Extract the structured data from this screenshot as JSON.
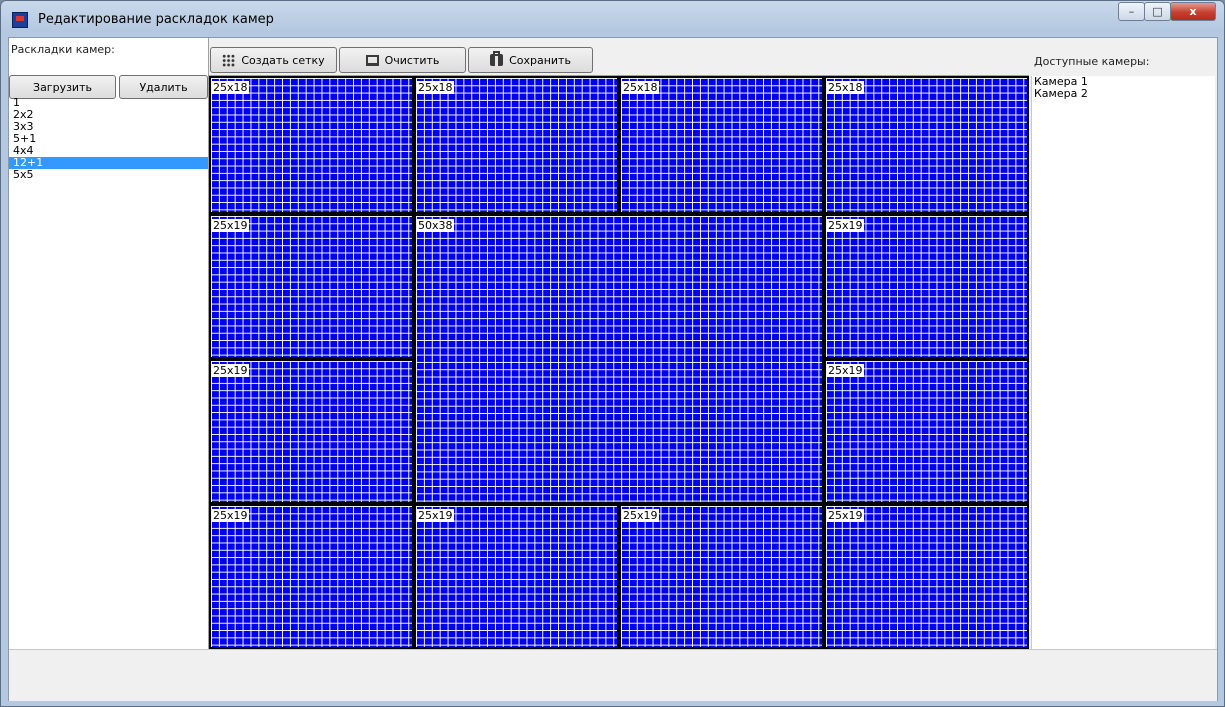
{
  "window": {
    "title": "Редактирование раскладок камер",
    "controls": {
      "minimize": "–",
      "maximize": "□",
      "close": "x"
    }
  },
  "left_panel": {
    "label": "Раскладки камер:",
    "load_label": "Загрузить",
    "delete_label": "Удалить",
    "layouts": [
      "1",
      "2x2",
      "3x3",
      "5+1",
      "4x4",
      "12+1",
      "5x5"
    ],
    "selected_index": 5
  },
  "toolbar": {
    "create_grid_label": "Создать сетку",
    "clear_label": "Очистить",
    "save_label": "Сохранить",
    "icons": {
      "create_grid": "grid-icon",
      "clear": "monitor-icon",
      "save": "briefcase-icon"
    }
  },
  "grid": {
    "cells": [
      {
        "label": "25x18"
      },
      {
        "label": "25x18"
      },
      {
        "label": "25x18"
      },
      {
        "label": "25x18"
      },
      {
        "label": "25x19"
      },
      {
        "label": "50x38"
      },
      {
        "label": "25x19"
      },
      {
        "label": "25x19"
      },
      {
        "label": "25x19"
      },
      {
        "label": "25x19"
      },
      {
        "label": "25x19"
      },
      {
        "label": "25x19"
      },
      {
        "label": "25x19"
      }
    ]
  },
  "right_panel": {
    "label": "Доступные камеры:",
    "cameras": [
      "Камера 1",
      "Камера 2"
    ]
  },
  "colors": {
    "cell_fill": "#0000f0",
    "selection": "#3399ff",
    "grid_lines": "#ffffff"
  }
}
